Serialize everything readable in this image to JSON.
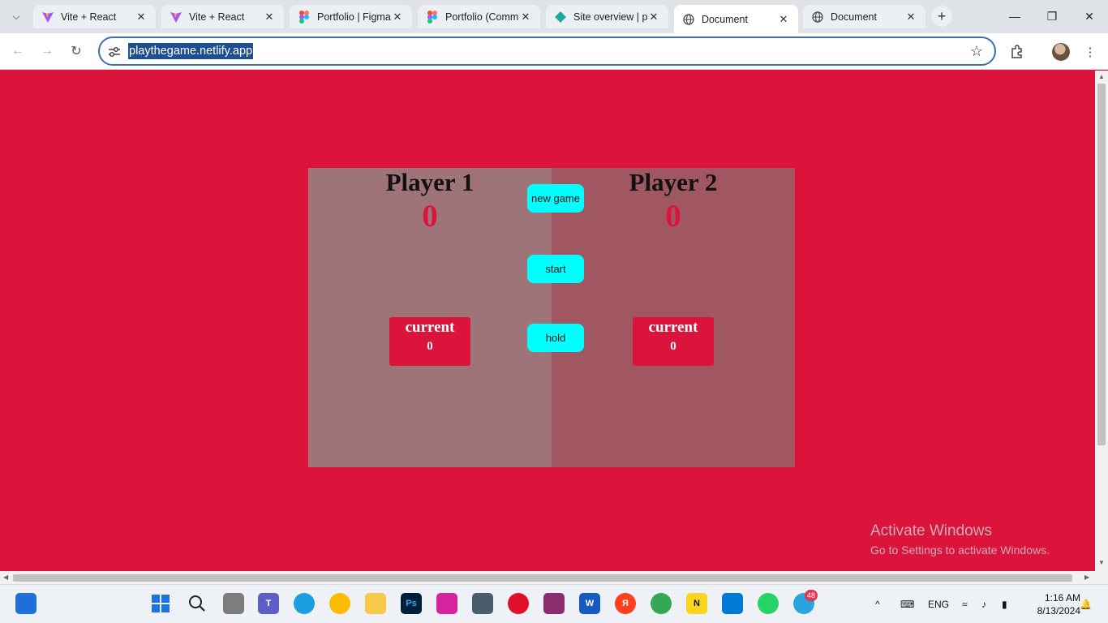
{
  "browser": {
    "tabs": [
      {
        "title": "Vite + React",
        "icon": "vite-icon"
      },
      {
        "title": "Vite + React",
        "icon": "vite-icon"
      },
      {
        "title": "Portfolio | Figma",
        "icon": "figma-icon"
      },
      {
        "title": "Portfolio (Comm",
        "icon": "figma-icon"
      },
      {
        "title": "Site overview | p",
        "icon": "netlify-icon"
      },
      {
        "title": "Document",
        "icon": "globe-icon",
        "active": true
      },
      {
        "title": "Document",
        "icon": "globe-icon"
      }
    ],
    "url": "playthegame.netlify.app"
  },
  "game": {
    "player1": {
      "name": "Player 1",
      "score": "0",
      "current_label": "current",
      "current_value": "0"
    },
    "player2": {
      "name": "Player 2",
      "score": "0",
      "current_label": "current",
      "current_value": "0"
    },
    "buttons": {
      "new_game": "new game",
      "start": "start",
      "hold": "hold"
    }
  },
  "watermark": {
    "title": "Activate Windows",
    "subtitle": "Go to Settings to activate Windows."
  },
  "taskbar": {
    "language": "ENG",
    "time": "1:16 AM",
    "date": "8/13/2024",
    "telegram_badge": "48"
  },
  "colors": {
    "page_bg": "#dc143c",
    "panel_1": "#9f7479",
    "panel_2": "#a15762",
    "button": "#00ffff"
  }
}
